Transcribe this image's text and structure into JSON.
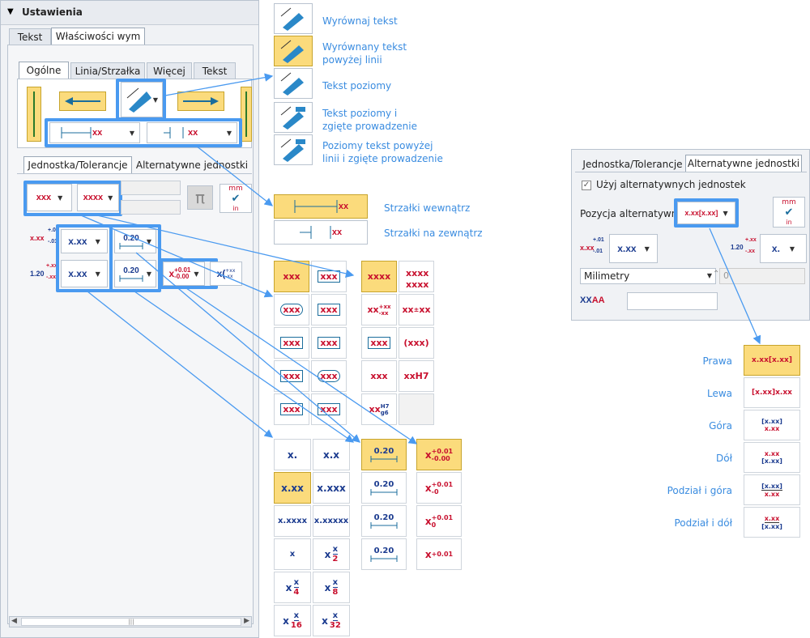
{
  "left_panel": {
    "header": "Ustawienia",
    "tabs": [
      "Tekst",
      "Właściwości wym"
    ],
    "sub_tabs": [
      "Ogólne",
      "Linia/Strzałka",
      "Więcej",
      "Tekst"
    ],
    "lower_tabs": [
      "Jednostka/Tolerancje",
      "Alternatywne jednostki"
    ],
    "arrow_fmt_1": "xx",
    "arrow_fmt_2": "xx",
    "unit_1": "xxx",
    "unit_2": "xxxx",
    "prec_1": "x.xx",
    "prec_2": "x.xx",
    "tol_1": "0.20",
    "tol_2": "0.20",
    "tol_row1_prefix": "x.xx",
    "tol_row1_up": "+.01",
    "tol_row1_low": "-.01",
    "tol_row2_prefix": "1.20",
    "tol_row2_up": "+.xx",
    "tol_row2_low": "-.xx",
    "tol_sel_main": "x",
    "tol_sel_up": "+0.01",
    "tol_sel_low": "-0.00",
    "tol_paren": "x(",
    "tol_paren_up": "+xx",
    "tol_paren_low": "-xx",
    "scroll_mark": "|||",
    "mm_label": "mm",
    "in_label": "in"
  },
  "text_align_options": [
    {
      "label": "Wyrównaj tekst"
    },
    {
      "label1": "Wyrównany tekst",
      "label2": "powyżej linii"
    },
    {
      "label": "Tekst poziomy"
    },
    {
      "label1": "Tekst poziomy i",
      "label2": "zgięte prowadzenie"
    },
    {
      "label1": "Poziomy tekst powyżej",
      "label2": "linii i zgięte prowadzenie"
    }
  ],
  "arrow_options": [
    {
      "label": "Strzałki wewnątrz",
      "fmt": "xx"
    },
    {
      "label": "Strzałki na zewnątrz",
      "fmt": "xx"
    }
  ],
  "unit_grid_left": [
    "xxx",
    "xxx",
    "xxx",
    "xxx",
    "xxx",
    "xxx",
    "xxx",
    "xxx",
    "xxx",
    "xxx"
  ],
  "unit_grid_right": [
    "xxxx",
    "xxxx",
    "xx",
    "xx",
    "xx",
    "xx",
    "xxx",
    "(xxx)",
    "xxx",
    "xxH7",
    "xx"
  ],
  "unit_grid_right_extra": {
    "xxxx2": "xxxx",
    "stack_up": "+xx",
    "stack_low": "-xx",
    "pm": "±",
    "h7": "H7",
    "g6": "g6"
  },
  "prec_grid": [
    "x.",
    "x.x",
    "x.xx",
    "x.xxx",
    "x.xxxx",
    "x.xxxxx",
    "x",
    "x",
    "x",
    "x",
    "x",
    "x"
  ],
  "prec_frac": [
    {
      "n": "x",
      "d": "2"
    },
    {
      "n": "x",
      "d": "4"
    },
    {
      "n": "x",
      "d": "8"
    },
    {
      "n": "x",
      "d": "16"
    },
    {
      "n": "x",
      "d": "32"
    }
  ],
  "tol_grid": [
    "0.20",
    "0.20",
    "0.20",
    "0.20"
  ],
  "tol_val_grid": [
    {
      "m": "x",
      "u": "+0.01",
      "l": "-0.00"
    },
    {
      "m": "x",
      "u": "+0.01",
      "l": "-0"
    },
    {
      "m": "x",
      "u": "+0.01",
      "l": "0"
    },
    {
      "m": "x",
      "u": "+0.01",
      "l": ""
    }
  ],
  "alt_panel": {
    "tabs": [
      "Jednostka/Tolerancje",
      "Alternatywne jednostki"
    ],
    "checkbox": "Użyj alternatywnych jednostek",
    "position_label": "Pozycja alternatywna",
    "position_value": "x.xx[x.xx]",
    "prec": "x.xx",
    "prec2": "x.",
    "tol_left": "x.xx",
    "tol_left_up": "+.01",
    "tol_left_low": "-.01",
    "tol_right": "1.20",
    "tol_right_up": "+.xx",
    "tol_right_low": "-.xx",
    "unit_select": "Milimetry",
    "unit_value": "0",
    "xxaa_a": "XX",
    "xxaa_b": "AA",
    "mm": "mm",
    "in": "in"
  },
  "position_options": [
    {
      "label": "Prawa",
      "value": "x.xx[x.xx]"
    },
    {
      "label": "Lewa",
      "value": "[x.xx]x.xx"
    },
    {
      "label": "Góra",
      "top": "[x.xx]",
      "bottom": "x.xx"
    },
    {
      "label": "Dół",
      "top": "x.xx",
      "bottom": "[x.xx]"
    },
    {
      "label": "Podział i góra",
      "top": "[x.xx]",
      "bottom": "x.xx"
    },
    {
      "label": "Podział i dół",
      "top": "x.xx",
      "bottom": "[x.xx]"
    }
  ],
  "colors": {
    "accent": "#4a9af0",
    "highlight": "#fbdb7c",
    "red": "#c8102e",
    "blue": "#1b3b8f",
    "label_blue": "#3a8ce0"
  }
}
